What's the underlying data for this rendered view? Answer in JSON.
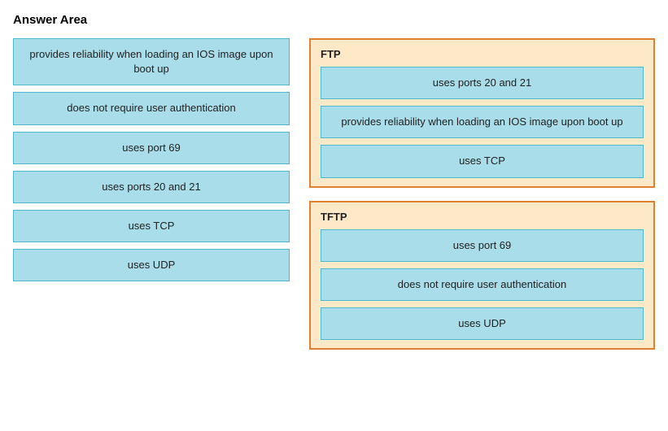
{
  "title": "Answer Area",
  "left_column": {
    "items": [
      {
        "id": "provides-reliability",
        "text": "provides reliability when loading an IOS image upon boot up"
      },
      {
        "id": "no-auth",
        "text": "does not require user authentication"
      },
      {
        "id": "port-69",
        "text": "uses port 69"
      },
      {
        "id": "ports-20-21",
        "text": "uses ports 20 and 21"
      },
      {
        "id": "uses-tcp",
        "text": "uses TCP"
      },
      {
        "id": "uses-udp",
        "text": "uses UDP"
      }
    ]
  },
  "right_column": {
    "protocols": [
      {
        "id": "ftp",
        "label": "FTP",
        "items": [
          {
            "id": "ftp-ports",
            "text": "uses ports 20 and 21"
          },
          {
            "id": "ftp-reliability",
            "text": "provides reliability when loading an IOS image upon boot up"
          },
          {
            "id": "ftp-tcp",
            "text": "uses TCP"
          }
        ]
      },
      {
        "id": "tftp",
        "label": "TFTP",
        "items": [
          {
            "id": "tftp-port69",
            "text": "uses port 69"
          },
          {
            "id": "tftp-noauth",
            "text": "does not require user authentication"
          },
          {
            "id": "tftp-udp",
            "text": "uses UDP"
          }
        ]
      }
    ]
  }
}
